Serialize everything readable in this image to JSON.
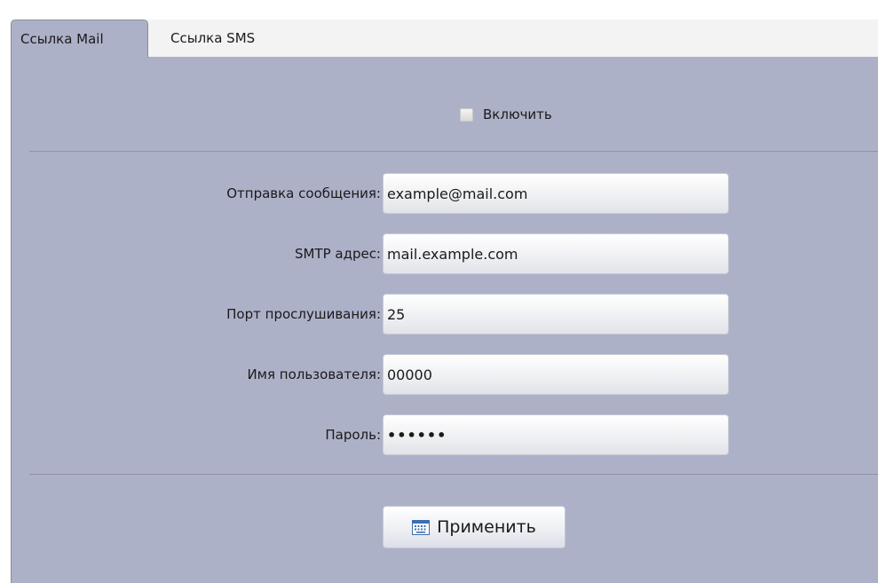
{
  "tabs": [
    {
      "label": "Ссылка Mail",
      "active": true
    },
    {
      "label": "Ссылка SMS",
      "active": false
    }
  ],
  "enable": {
    "label": "Включить",
    "checked": false
  },
  "fields": {
    "sender": {
      "label": "Отправка сообщения:",
      "value": "example@mail.com"
    },
    "smtp": {
      "label": "SMTP адрес:",
      "value": "mail.example.com"
    },
    "port": {
      "label": "Порт прослушивания:",
      "value": "25"
    },
    "username": {
      "label": "Имя пользователя:",
      "value": "00000"
    },
    "password": {
      "label": "Пароль:",
      "value": "••••••"
    }
  },
  "apply_button": {
    "label": "Применить",
    "icon": "keyboard-icon"
  },
  "colors": {
    "panel_bg": "#adb1c8",
    "tabbar_bg": "#f3f3f3",
    "icon_blue": "#3a6fb0"
  }
}
